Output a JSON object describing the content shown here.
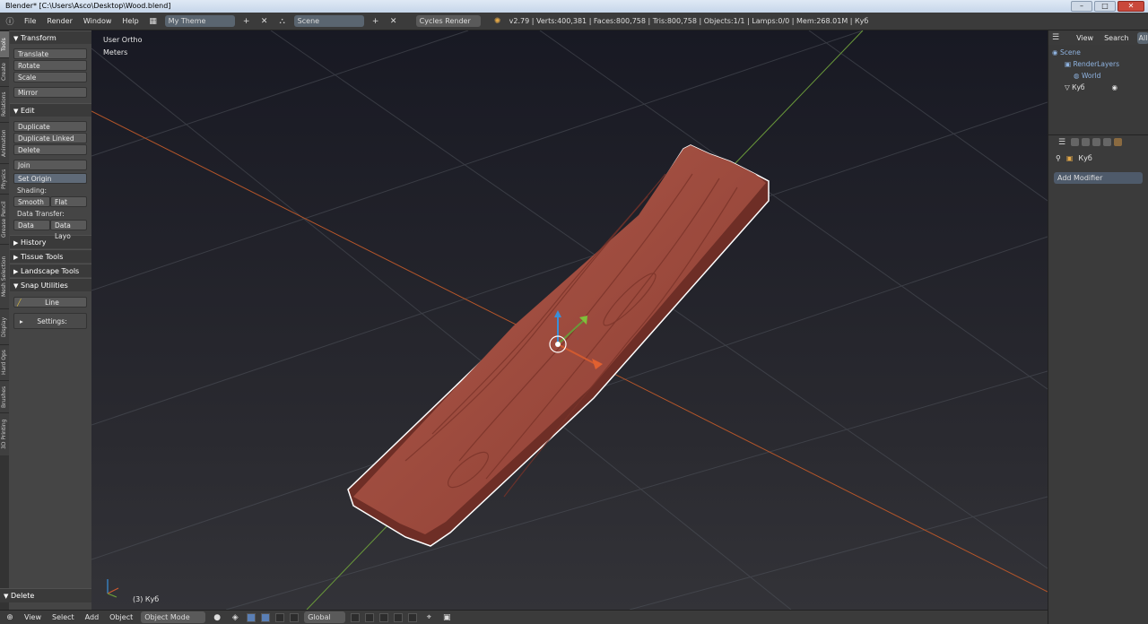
{
  "window": {
    "title": "Blender* [C:\\Users\\Asco\\Desktop\\Wood.blend]"
  },
  "topbar": {
    "menus": [
      "File",
      "Render",
      "Window",
      "Help"
    ],
    "screen_layout": "My Theme",
    "scene": "Scene",
    "render_engine": "Cycles Render",
    "status": "v2.79 | Verts:400,381 | Faces:800,758 | Tris:800,758 | Objects:1/1 | Lamps:0/0 | Mem:268.01M | Куб"
  },
  "tabs": [
    "Tools",
    "Create",
    "Relations",
    "Animation",
    "Physics",
    "Grease Pencil",
    "Mesh Selection",
    "Display",
    "Hard Ops",
    "Brushes",
    "3D Printing"
  ],
  "tools": {
    "transform": {
      "title": "Transform",
      "buttons": [
        "Translate",
        "Rotate",
        "Scale",
        "Mirror"
      ]
    },
    "edit": {
      "title": "Edit",
      "buttons": [
        "Duplicate",
        "Duplicate Linked",
        "Delete",
        "Join"
      ],
      "set_origin": "Set Origin",
      "shading_label": "Shading:",
      "smooth": "Smooth",
      "flat": "Flat",
      "data_transfer_label": "Data Transfer:",
      "data": "Data",
      "data_layout": "Data Layo"
    },
    "collapsed": [
      "History",
      "Tissue Tools",
      "Landscape Tools"
    ],
    "snap": {
      "title": "Snap Utilities",
      "line": "Line",
      "settings": "Settings:"
    },
    "operator": "Delete"
  },
  "viewport": {
    "view_name": "User Ortho",
    "units": "Meters",
    "object_label": "(3) Куб"
  },
  "outliner": {
    "view": "View",
    "search": "Search",
    "all": "All",
    "rows": [
      "Scene",
      "RenderLayers",
      "World",
      "Куб"
    ]
  },
  "properties": {
    "object": "Куб",
    "add_modifier": "Add Modifier"
  },
  "bottombar": {
    "menus": [
      "View",
      "Select",
      "Add",
      "Object"
    ],
    "mode": "Object Mode",
    "orientation": "Global"
  },
  "colors": {
    "wood": "#9e4a3e",
    "wood_dark": "#6e2e26",
    "x_axis": "#b5562a",
    "y_axis": "#6a9a3a",
    "z_axis": "#3a8fd8"
  }
}
